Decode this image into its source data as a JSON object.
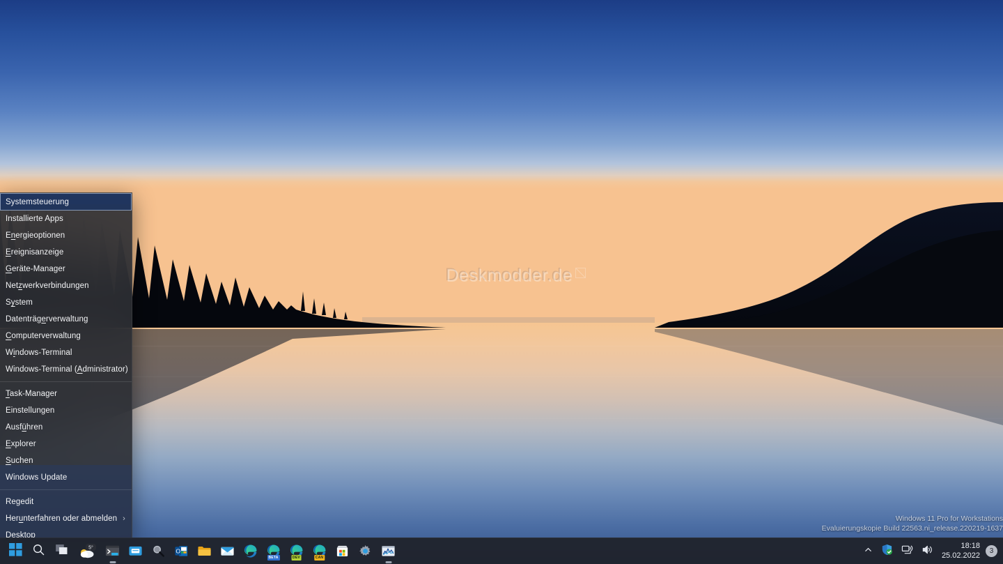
{
  "desktop": {
    "wallpaper_name": "sunset-lake-wallpaper",
    "watermark": {
      "text": "Deskmodder.de",
      "icon": "square-slash-icon"
    },
    "build_watermark": {
      "line1": "Windows 11 Pro for Workstations",
      "line2": "Evaluierungskopie Build 22563.ni_release.220219-1637"
    }
  },
  "colors": {
    "accent": "#2f9de0",
    "menu_bg": "#2b2d33",
    "menu_selected_bg": "#1e345e",
    "taskbar_bg": "#20232b",
    "text": "#f3f4f6"
  },
  "winx_menu": {
    "groups": [
      {
        "items": [
          {
            "label": "Systemsteuerung",
            "accel_index": -1,
            "selected": true,
            "submenu": false
          },
          {
            "label": "Installierte Apps",
            "accel_index": -1,
            "selected": false,
            "submenu": false
          },
          {
            "label": "Energieoptionen",
            "accel_index": 1,
            "selected": false,
            "submenu": false
          },
          {
            "label": "Ereignisanzeige",
            "accel_index": 0,
            "selected": false,
            "submenu": false
          },
          {
            "label": "Geräte-Manager",
            "accel_index": 0,
            "selected": false,
            "submenu": false
          },
          {
            "label": "Netzwerkverbindungen",
            "accel_index": 3,
            "selected": false,
            "submenu": false
          },
          {
            "label": "System",
            "accel_index": 1,
            "selected": false,
            "submenu": false
          },
          {
            "label": "Datenträgerverwaltung",
            "accel_index": 9,
            "selected": false,
            "submenu": false
          },
          {
            "label": "Computerverwaltung",
            "accel_index": 0,
            "selected": false,
            "submenu": false
          },
          {
            "label": "Windows-Terminal",
            "accel_index": 1,
            "selected": false,
            "submenu": false
          },
          {
            "label": "Windows-Terminal (Administrator)",
            "accel_index": 18,
            "selected": false,
            "submenu": false
          }
        ]
      },
      {
        "items": [
          {
            "label": "Task-Manager",
            "accel_index": 0,
            "selected": false,
            "submenu": false
          },
          {
            "label": "Einstellungen",
            "accel_index": -1,
            "selected": false,
            "submenu": false
          },
          {
            "label": "Ausführen",
            "accel_index": 4,
            "selected": false,
            "submenu": false
          },
          {
            "label": "Explorer",
            "accel_index": 0,
            "selected": false,
            "submenu": false
          },
          {
            "label": "Suchen",
            "accel_index": 0,
            "selected": false,
            "submenu": false
          },
          {
            "label": "Windows Update",
            "accel_index": -1,
            "selected": false,
            "submenu": false
          }
        ]
      },
      {
        "items": [
          {
            "label": "Regedit",
            "accel_index": -1,
            "selected": false,
            "submenu": false
          },
          {
            "label": "Herunterfahren oder abmelden",
            "accel_index": 3,
            "selected": false,
            "submenu": true,
            "submenu_glyph": "›"
          },
          {
            "label": "Desktop",
            "accel_index": 0,
            "selected": false,
            "submenu": false
          }
        ]
      }
    ]
  },
  "taskbar": {
    "left_items": [
      {
        "name": "start-button",
        "icon": "windows-logo-icon",
        "label": "Start",
        "running": false
      },
      {
        "name": "search-button",
        "icon": "search-icon",
        "label": "Suchen",
        "running": false
      },
      {
        "name": "task-view-button",
        "icon": "task-view-icon",
        "label": "Taskansicht",
        "running": false
      },
      {
        "name": "weather-widget",
        "icon": "weather-cloud-icon",
        "label": "Wetter",
        "temperature": "5°",
        "running": false
      }
    ],
    "pinned_items": [
      {
        "name": "taskbar-app-windows-terminal",
        "icon": "terminal-icon",
        "label": "Windows-Terminal",
        "running": true
      },
      {
        "name": "taskbar-app-notepad",
        "icon": "notepad-window-icon",
        "label": "Editor",
        "running": false
      },
      {
        "name": "taskbar-app-search-everything",
        "icon": "magnifier-dark-icon",
        "label": "Suche",
        "running": false
      },
      {
        "name": "taskbar-app-outlook",
        "icon": "outlook-icon",
        "label": "Outlook",
        "running": false
      },
      {
        "name": "taskbar-app-file-explorer",
        "icon": "folder-icon",
        "label": "Explorer",
        "running": false
      },
      {
        "name": "taskbar-app-mail",
        "icon": "mail-envelope-icon",
        "label": "Mail",
        "running": false
      },
      {
        "name": "taskbar-app-edge",
        "icon": "edge-icon",
        "label": "Microsoft Edge",
        "running": false,
        "tag": ""
      },
      {
        "name": "taskbar-app-edge-beta",
        "icon": "edge-icon",
        "label": "Microsoft Edge Beta",
        "running": false,
        "tag": "BETA",
        "tag_color": "#2f6fd0"
      },
      {
        "name": "taskbar-app-edge-dev",
        "icon": "edge-icon",
        "label": "Microsoft Edge Dev",
        "running": false,
        "tag": "DEV",
        "tag_color": "#b5d334"
      },
      {
        "name": "taskbar-app-edge-canary",
        "icon": "edge-icon",
        "label": "Microsoft Edge Canary",
        "running": false,
        "tag": "CAN",
        "tag_color": "#f3b41b"
      },
      {
        "name": "taskbar-app-microsoft-store",
        "icon": "store-bag-icon",
        "label": "Microsoft Store",
        "running": false
      },
      {
        "name": "taskbar-app-settings",
        "icon": "gear-icon",
        "label": "Einstellungen",
        "running": false
      },
      {
        "name": "taskbar-app-performance-monitor",
        "icon": "chart-monitor-icon",
        "label": "Leistungsüberwachung",
        "running": true
      }
    ],
    "tray": {
      "overflow_glyph": "⌃",
      "items": [
        {
          "name": "tray-defender-icon",
          "icon": "shield-check-icon",
          "label": "Windows-Sicherheit"
        },
        {
          "name": "tray-network-icon",
          "icon": "network-icon",
          "label": "Netzwerk"
        },
        {
          "name": "tray-volume-icon",
          "icon": "speaker-icon",
          "label": "Lautstärke"
        }
      ],
      "clock": {
        "time": "18:18",
        "date": "25.02.2022"
      },
      "notification_count": "3"
    }
  }
}
